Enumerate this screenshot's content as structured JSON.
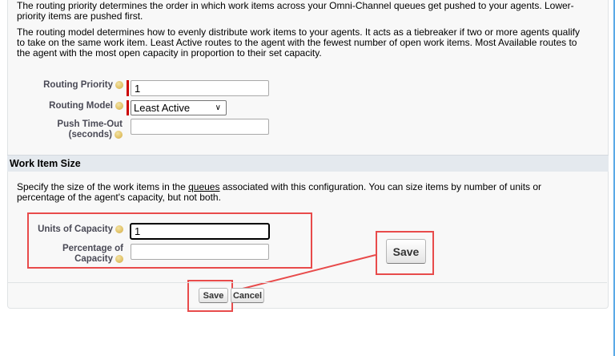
{
  "routing": {
    "priority_desc_1": "The routing priority determines the order in which work items across your Omni-Channel queues get pushed to your agents. Lower-",
    "priority_desc_2": "priority items are pushed first.",
    "model_desc_1": "The routing model determines how to evenly distribute work items to your agents. It acts as a tiebreaker if two or more agents qualify",
    "model_desc_2": "to take on the same work item. Least Active routes to the agent with the fewest number of open work items. Most Available routes to",
    "model_desc_3": "the agent with the most open capacity in proportion to their set capacity.",
    "priority_label": "Routing Priority",
    "priority_value": "1",
    "model_label": "Routing Model",
    "model_value": "Least Active",
    "timeout_label_1": "Push Time-Out",
    "timeout_label_2": "(seconds)",
    "timeout_value": ""
  },
  "work_item_size": {
    "title": "Work Item Size",
    "desc_1_pre": "Specify the size of the work items in the ",
    "desc_1_link": "queues",
    "desc_1_post": " associated with this configuration. You can size items by number of units or",
    "desc_2": "percentage of the agent's capacity, but not both.",
    "units_label": "Units of Capacity",
    "units_value": "1",
    "percentage_label_1": "Percentage of",
    "percentage_label_2": "Capacity",
    "percentage_value": ""
  },
  "buttons": {
    "save": "Save",
    "cancel": "Cancel",
    "save_zoom": "Save"
  },
  "colors": {
    "callout": "#e84b4b",
    "required": "#cc0000"
  }
}
